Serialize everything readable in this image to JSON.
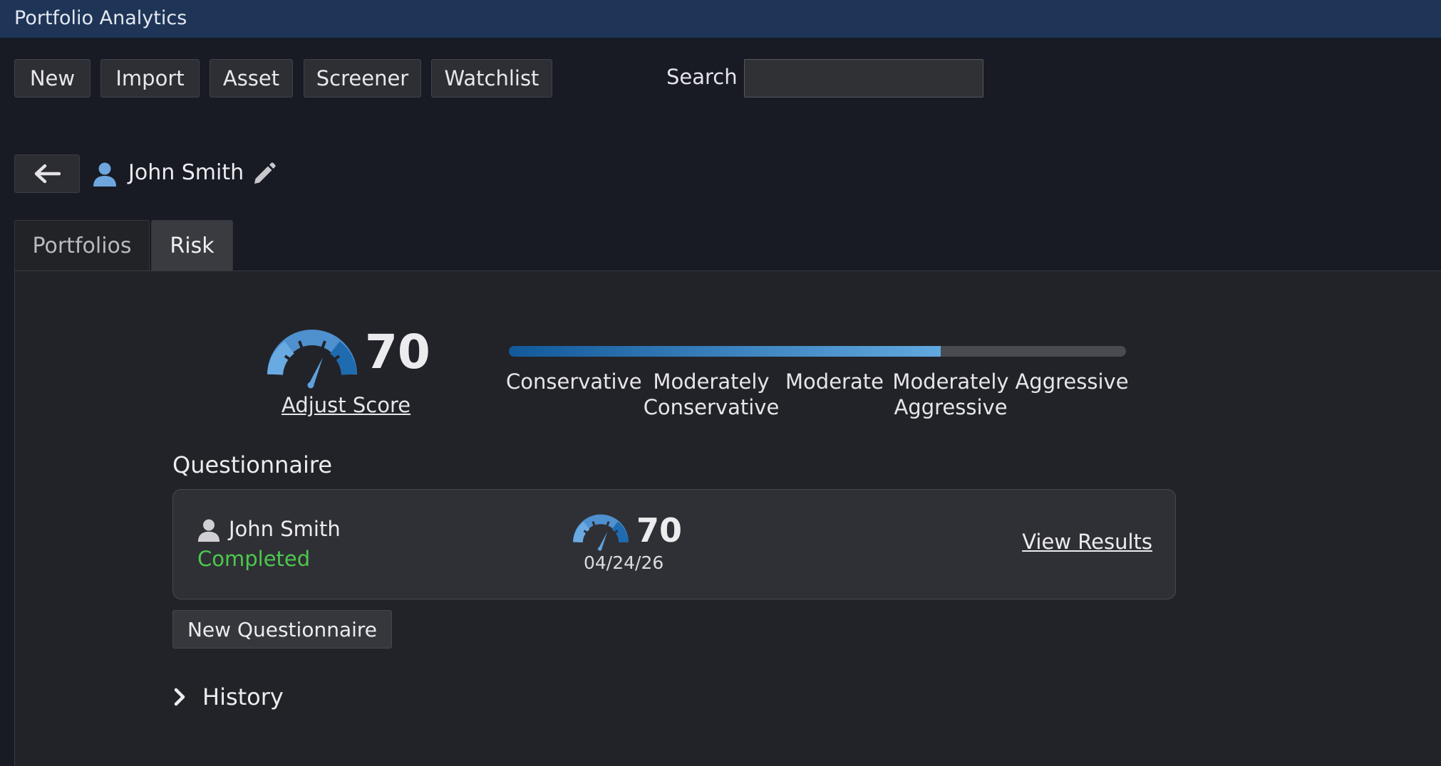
{
  "app": {
    "title": "Portfolio Analytics"
  },
  "toolbar": {
    "buttons": [
      {
        "label": "New"
      },
      {
        "label": "Import"
      },
      {
        "label": "Asset"
      },
      {
        "label": "Screener"
      },
      {
        "label": "Watchlist"
      }
    ],
    "search_label": "Search",
    "search_value": "",
    "search_placeholder": ""
  },
  "client": {
    "name": "John Smith",
    "icons": {
      "back": "arrow-left-icon",
      "user": "user-icon",
      "edit": "pencil-icon"
    }
  },
  "tabs": [
    {
      "label": "Portfolios",
      "active": false
    },
    {
      "label": "Risk",
      "active": true
    }
  ],
  "risk": {
    "score": "70",
    "score_fraction": 0.7,
    "adjust_label": "Adjust Score",
    "scale_labels": [
      {
        "line1": "Conservative",
        "line2": ""
      },
      {
        "line1": "Moderately",
        "line2": "Conservative"
      },
      {
        "line1": "Moderate",
        "line2": ""
      },
      {
        "line1": "Moderately",
        "line2": "Aggressive"
      },
      {
        "line1": "Aggressive",
        "line2": ""
      }
    ],
    "colors": {
      "fill_start": "#12599a",
      "fill_end": "#61a8df",
      "track": "#4a4b50"
    }
  },
  "questionnaire": {
    "section_title": "Questionnaire",
    "entry": {
      "name": "John Smith",
      "status": "Completed",
      "status_color": "#4cc94c",
      "score": "70",
      "date": "04/24/26",
      "view_label": "View Results"
    },
    "new_button_label": "New Questionnaire"
  },
  "history": {
    "label": "History",
    "expanded": false
  }
}
